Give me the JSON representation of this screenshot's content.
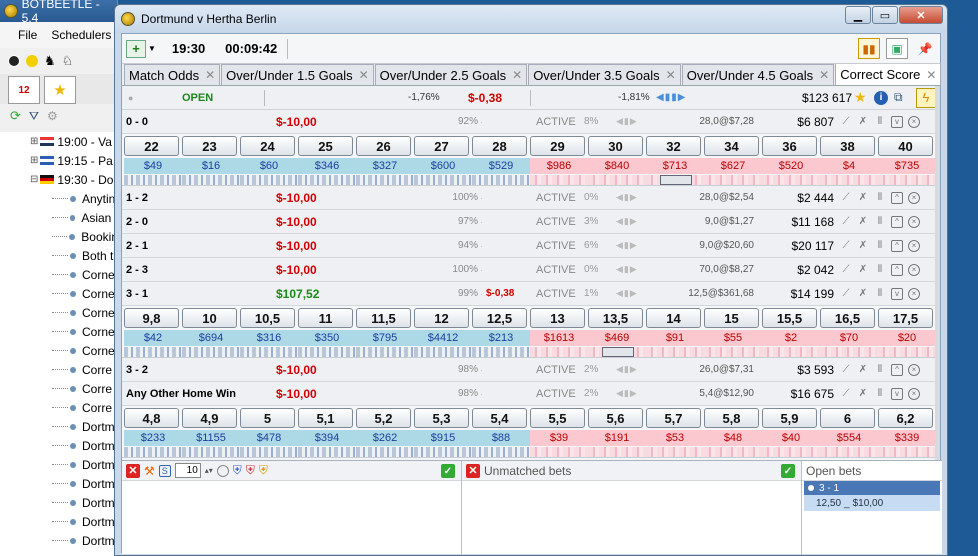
{
  "bg_window": {
    "title": "BOTBEETLE - 5.4",
    "menu": [
      "File",
      "Schedulers"
    ],
    "tree": {
      "events": [
        {
          "time": "19:00 - Va",
          "flag_colors": [
            "#e33",
            "#fff",
            "#235"
          ]
        },
        {
          "time": "19:15 - Pa",
          "flag_colors": [
            "#2a5fb0",
            "#fff",
            "#2a5fb0"
          ]
        },
        {
          "time": "19:30 - Do",
          "flag_colors": [
            "#111",
            "#c00",
            "#fc0"
          ]
        }
      ],
      "markets": [
        "Anytin",
        "Asian I",
        "Bookin",
        "Both t",
        "Corne",
        "Corne",
        "Corne",
        "Corne",
        "Corne",
        "Corre",
        "Corre",
        "Corre",
        "Dortm",
        "Dortm",
        "Dortm",
        "Dortm",
        "Dortm",
        "Dortm",
        "Dortm"
      ]
    }
  },
  "window": {
    "title": "Dortmund v Hertha Berlin",
    "controls": {
      "minimize": "▁",
      "maximize": "▭",
      "close": "✕"
    }
  },
  "toolbar": {
    "kickoff": "19:30",
    "countdown": "00:09:42"
  },
  "tabs": [
    {
      "label": "Match Odds",
      "active": false
    },
    {
      "label": "Over/Under 1.5 Goals",
      "active": false
    },
    {
      "label": "Over/Under 2.5 Goals",
      "active": false
    },
    {
      "label": "Over/Under 3.5 Goals",
      "active": false
    },
    {
      "label": "Over/Under 4.5 Goals",
      "active": false
    },
    {
      "label": "Correct Score",
      "active": true
    }
  ],
  "market_header": {
    "status": "OPEN",
    "pct_left": "-1,76%",
    "pl_total": "$-0,38",
    "pct_right": "-1,81%",
    "total_matched": "$123 617"
  },
  "rows": [
    {
      "name": "0 - 0",
      "pl": "$-10,00",
      "pl_sign": "neg",
      "pct": "92%",
      "extra": "",
      "status": "ACTIVE",
      "status_pct": "8%",
      "last_bet": "28,0@$7,28",
      "matched": "$6 807",
      "ladder": {
        "prices": [
          "22",
          "23",
          "24",
          "25",
          "26",
          "27",
          "28",
          "29",
          "30",
          "32",
          "34",
          "36",
          "38",
          "40"
        ],
        "amounts": [
          "$49",
          "$16",
          "$60",
          "$346",
          "$327",
          "$600",
          "$529",
          "$986",
          "$840",
          "$713",
          "$627",
          "$520",
          "$4",
          "$735"
        ],
        "back_count": 7,
        "thumb_index": 9
      }
    },
    {
      "name": "1 - 2",
      "pl": "$-10,00",
      "pl_sign": "neg",
      "pct": "100%",
      "extra": "",
      "status": "ACTIVE",
      "status_pct": "0%",
      "last_bet": "28,0@$2,54",
      "matched": "$2 444"
    },
    {
      "name": "2 - 0",
      "pl": "$-10,00",
      "pl_sign": "neg",
      "pct": "97%",
      "extra": "",
      "status": "ACTIVE",
      "status_pct": "3%",
      "last_bet": "9,0@$1,27",
      "matched": "$11 168"
    },
    {
      "name": "2 - 1",
      "pl": "$-10,00",
      "pl_sign": "neg",
      "pct": "94%",
      "extra": "",
      "status": "ACTIVE",
      "status_pct": "6%",
      "last_bet": "9,0@$20,60",
      "matched": "$20 117"
    },
    {
      "name": "2 - 3",
      "pl": "$-10,00",
      "pl_sign": "neg",
      "pct": "100%",
      "extra": "",
      "status": "ACTIVE",
      "status_pct": "0%",
      "last_bet": "70,0@$8,27",
      "matched": "$2 042"
    },
    {
      "name": "3 - 1",
      "pl": "$107,52",
      "pl_sign": "pos",
      "pct": "99%",
      "extra": "$-0,38",
      "status": "ACTIVE",
      "status_pct": "1%",
      "last_bet": "12,5@$361,68",
      "matched": "$14 199",
      "ladder": {
        "prices": [
          "9,8",
          "10",
          "10,5",
          "11",
          "11,5",
          "12",
          "12,5",
          "13",
          "13,5",
          "14",
          "15",
          "15,5",
          "16,5",
          "17,5"
        ],
        "amounts": [
          "$42",
          "$694",
          "$316",
          "$350",
          "$795",
          "$4412",
          "$213",
          "$1613",
          "$469",
          "$91",
          "$55",
          "$2",
          "$70",
          "$20"
        ],
        "back_count": 7,
        "thumb_index": 8
      }
    },
    {
      "name": "3 - 2",
      "pl": "$-10,00",
      "pl_sign": "neg",
      "pct": "98%",
      "extra": "",
      "status": "ACTIVE",
      "status_pct": "2%",
      "last_bet": "26,0@$7,31",
      "matched": "$3 593"
    },
    {
      "name": "Any Other Home Win",
      "pl": "$-10,00",
      "pl_sign": "neg",
      "pct": "98%",
      "extra": "",
      "status": "ACTIVE",
      "status_pct": "2%",
      "last_bet": "5,4@$12,90",
      "matched": "$16 675",
      "ladder": {
        "prices": [
          "4,8",
          "4,9",
          "5",
          "5,1",
          "5,2",
          "5,3",
          "5,4",
          "5,5",
          "5,6",
          "5,7",
          "5,8",
          "5,9",
          "6",
          "6,2"
        ],
        "amounts": [
          "$233",
          "$1155",
          "$478",
          "$394",
          "$262",
          "$915",
          "$88",
          "$39",
          "$191",
          "$53",
          "$48",
          "$40",
          "$554",
          "$339"
        ],
        "back_count": 7,
        "thumb_index": -1
      }
    }
  ],
  "bottom": {
    "stake_value": "10",
    "unmatched_label": "Unmatched bets",
    "open_label": "Open bets",
    "open_bet": {
      "selection": "3 - 1",
      "price": "12,50",
      "stake": "$10,00"
    }
  },
  "colors": {
    "back": "#add8e6",
    "lay": "#fbc8cf",
    "open": "#1a8a1a",
    "neg": "#d40000"
  }
}
